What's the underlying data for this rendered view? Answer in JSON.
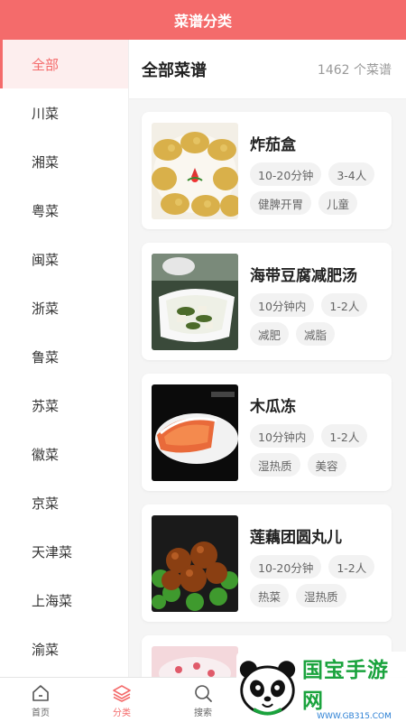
{
  "header": {
    "title": "菜谱分类"
  },
  "sidebar": {
    "items": [
      {
        "label": "全部"
      },
      {
        "label": "川菜"
      },
      {
        "label": "湘菜"
      },
      {
        "label": "粤菜"
      },
      {
        "label": "闽菜"
      },
      {
        "label": "浙菜"
      },
      {
        "label": "鲁菜"
      },
      {
        "label": "苏菜"
      },
      {
        "label": "徽菜"
      },
      {
        "label": "京菜"
      },
      {
        "label": "天津菜"
      },
      {
        "label": "上海菜"
      },
      {
        "label": "渝菜"
      }
    ]
  },
  "main": {
    "title": "全部菜谱",
    "count": "1462 个菜谱",
    "recipes": [
      {
        "name": "炸茄盒",
        "tags": [
          "10-20分钟",
          "3-4人",
          "健脾开胃",
          "儿童"
        ]
      },
      {
        "name": "海带豆腐减肥汤",
        "tags": [
          "10分钟内",
          "1-2人",
          "减肥",
          "减脂"
        ]
      },
      {
        "name": "木瓜冻",
        "tags": [
          "10分钟内",
          "1-2人",
          "湿热质",
          "美容"
        ]
      },
      {
        "name": "莲藕团圆丸儿",
        "tags": [
          "10-20分钟",
          "1-2人",
          "热菜",
          "湿热质"
        ]
      }
    ]
  },
  "tabbar": {
    "items": [
      {
        "label": "首页",
        "icon": "home-icon"
      },
      {
        "label": "分类",
        "icon": "layers-icon"
      },
      {
        "label": "搜索",
        "icon": "search-icon"
      }
    ]
  },
  "watermark": {
    "title": "国宝手游网",
    "url": "WWW.GB315.COM"
  },
  "colors": {
    "accent": "#f46b6b",
    "watermark_green": "#1aa33d"
  }
}
